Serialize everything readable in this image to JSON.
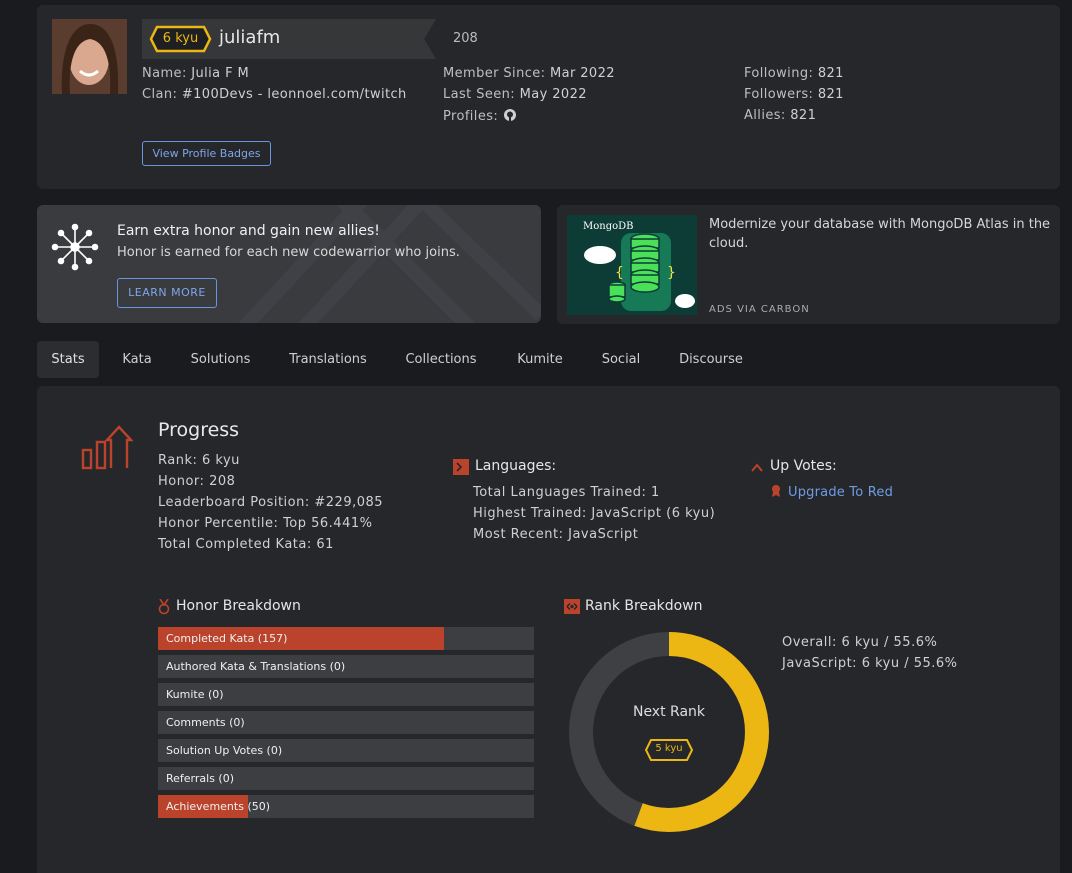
{
  "profile": {
    "rank": "6 kyu",
    "username": "juliafm",
    "honor": "208",
    "name_label": "Name:",
    "name": "Julia F M",
    "clan_label": "Clan:",
    "clan": "#100Devs - leonnoel.com/twitch",
    "member_since_label": "Member Since:",
    "member_since": "Mar 2022",
    "last_seen_label": "Last Seen:",
    "last_seen": "May 2022",
    "profiles_label": "Profiles:",
    "following_label": "Following:",
    "following": "821",
    "followers_label": "Followers:",
    "followers": "821",
    "allies_label": "Allies:",
    "allies": "821",
    "badges_button": "View Profile Badges"
  },
  "promo": {
    "title": "Earn extra honor and gain new allies!",
    "subtitle": "Honor is earned for each new codewarrior who joins.",
    "button": "LEARN MORE"
  },
  "ad": {
    "brand": "MongoDB",
    "text": "Modernize your database with MongoDB Atlas in the cloud.",
    "via": "ADS VIA CARBON"
  },
  "tabs": [
    {
      "label": "Stats"
    },
    {
      "label": "Kata"
    },
    {
      "label": "Solutions"
    },
    {
      "label": "Translations"
    },
    {
      "label": "Collections"
    },
    {
      "label": "Kumite"
    },
    {
      "label": "Social"
    },
    {
      "label": "Discourse"
    }
  ],
  "progress": {
    "title": "Progress",
    "rank_label": "Rank:",
    "rank": "6 kyu",
    "honor_label": "Honor:",
    "honor": "208",
    "leaderboard_label": "Leaderboard Position:",
    "leaderboard": "#229,085",
    "percentile_label": "Honor Percentile:",
    "percentile": "Top 56.441%",
    "completed_label": "Total Completed Kata:",
    "completed": "61"
  },
  "languages": {
    "title": "Languages:",
    "total_label": "Total Languages Trained:",
    "total": "1",
    "highest_label": "Highest Trained:",
    "highest": "JavaScript (6 kyu)",
    "recent_label": "Most Recent:",
    "recent": "JavaScript"
  },
  "upvotes": {
    "title": "Up Votes:",
    "link": "Upgrade To Red"
  },
  "honor_breakdown": {
    "title": "Honor Breakdown",
    "rows": [
      {
        "label": "Completed Kata (157)",
        "fill": 0.76
      },
      {
        "label": "Authored Kata & Translations (0)",
        "fill": 0
      },
      {
        "label": "Kumite (0)",
        "fill": 0
      },
      {
        "label": "Comments (0)",
        "fill": 0
      },
      {
        "label": "Solution Up Votes (0)",
        "fill": 0
      },
      {
        "label": "Referrals (0)",
        "fill": 0
      },
      {
        "label": "Achievements (50)",
        "fill": 0.24
      }
    ]
  },
  "rank_breakdown": {
    "title": "Rank Breakdown",
    "progress": 0.556,
    "next_rank_label": "Next Rank",
    "next_rank": "5 kyu",
    "overall_label": "Overall:",
    "overall": "6 kyu / 55.6%",
    "javascript_label": "JavaScript:",
    "javascript": "6 kyu / 55.6%"
  },
  "colors": {
    "accent_red": "#bb432c",
    "rank_yellow": "#ecb613",
    "link_blue": "#6f9de4",
    "panel_bg": "#26272b",
    "page_bg": "#1a1b1e"
  }
}
